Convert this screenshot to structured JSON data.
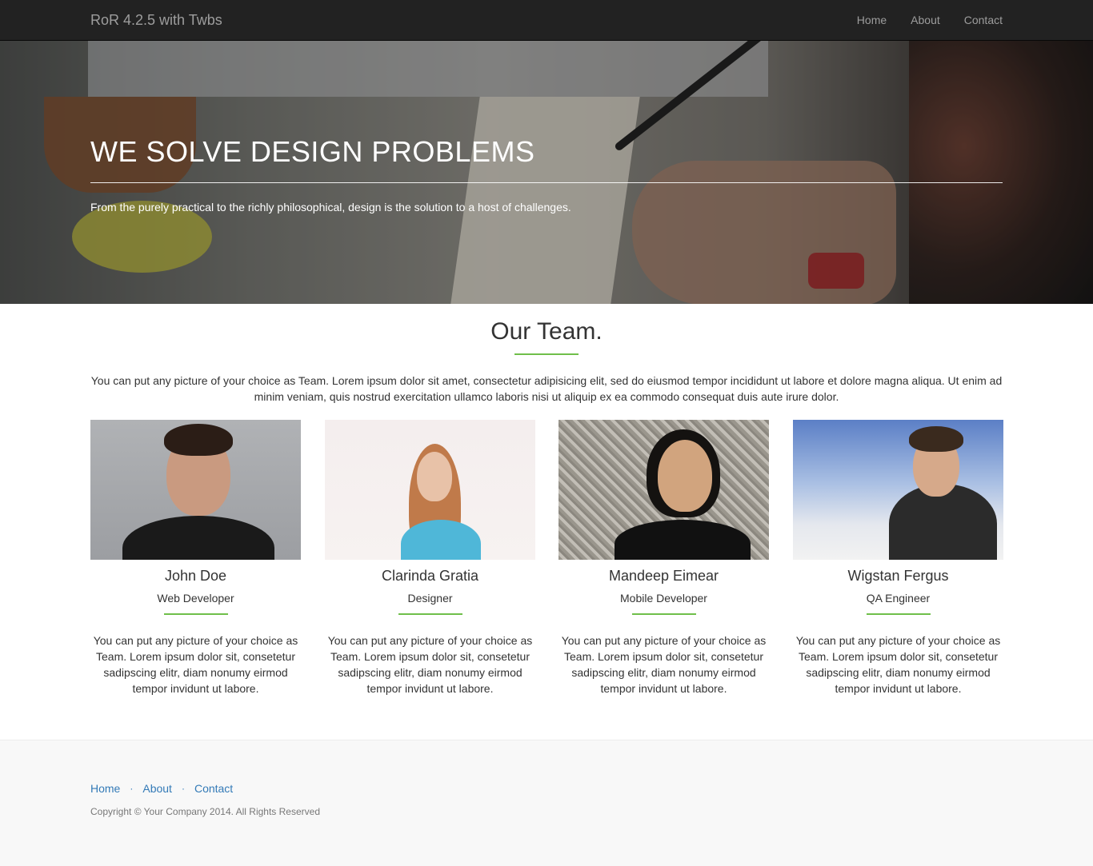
{
  "navbar": {
    "brand": "RoR 4.2.5 with Twbs",
    "links": [
      "Home",
      "About",
      "Contact"
    ]
  },
  "hero": {
    "title": "WE SOLVE DESIGN PROBLEMS",
    "subtitle": "From the purely practical to the richly philosophical, design is the solution to a host of challenges."
  },
  "team": {
    "title": "Our Team.",
    "intro": "You can put any picture of your choice as Team. Lorem ipsum dolor sit amet, consectetur adipisicing elit, sed do eiusmod tempor incididunt ut labore et dolore magna aliqua. Ut enim ad minim veniam, quis nostrud exercitation ullamco laboris nisi ut aliquip ex ea commodo consequat duis aute irure dolor.",
    "members": [
      {
        "name": "John Doe",
        "role": "Web Developer",
        "bio": "You can put any picture of your choice as Team. Lorem ipsum dolor sit, consetetur sadipscing elitr, diam nonumy eirmod tempor invidunt ut labore."
      },
      {
        "name": "Clarinda Gratia",
        "role": "Designer",
        "bio": "You can put any picture of your choice as Team. Lorem ipsum dolor sit, consetetur sadipscing elitr, diam nonumy eirmod tempor invidunt ut labore."
      },
      {
        "name": "Mandeep Eimear",
        "role": "Mobile Developer",
        "bio": "You can put any picture of your choice as Team. Lorem ipsum dolor sit, consetetur sadipscing elitr, diam nonumy eirmod tempor invidunt ut labore."
      },
      {
        "name": "Wigstan Fergus",
        "role": "QA Engineer",
        "bio": "You can put any picture of your choice as Team. Lorem ipsum dolor sit, consetetur sadipscing elitr, diam nonumy eirmod tempor invidunt ut labore."
      }
    ]
  },
  "footer": {
    "links": [
      "Home",
      "About",
      "Contact"
    ],
    "separator": "·",
    "copyright": "Copyright © Your Company 2014. All Rights Reserved"
  },
  "colors": {
    "accent": "#6fbf4a",
    "navbar": "#222222",
    "link": "#337ab7",
    "footer_bg": "#f8f8f8"
  }
}
